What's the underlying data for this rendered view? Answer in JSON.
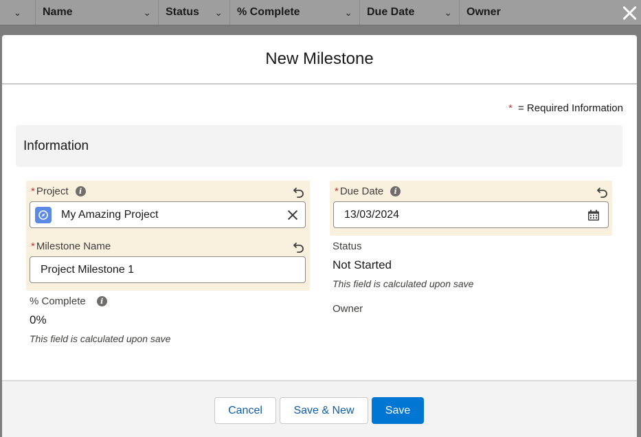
{
  "background_table": {
    "columns": [
      {
        "label": ""
      },
      {
        "label": "Name"
      },
      {
        "label": "Status"
      },
      {
        "label": "% Complete"
      },
      {
        "label": "Due Date"
      },
      {
        "label": "Owner"
      }
    ]
  },
  "modal": {
    "title": "New Milestone",
    "required_note": "= Required Information",
    "required_star": "*",
    "section_title": "Information",
    "fields": {
      "project": {
        "label": "Project",
        "value": "My Amazing Project"
      },
      "milestone_name": {
        "label": "Milestone Name",
        "value": "Project Milestone 1"
      },
      "percent_complete": {
        "label": "% Complete",
        "value": "0%",
        "note": "This field is calculated upon save"
      },
      "due_date": {
        "label": "Due Date",
        "value": "13/03/2024"
      },
      "status": {
        "label": "Status",
        "value": "Not Started",
        "note": "This field is calculated upon save"
      },
      "owner": {
        "label": "Owner"
      }
    },
    "buttons": {
      "cancel": "Cancel",
      "save_new": "Save & New",
      "save": "Save"
    }
  },
  "colors": {
    "brand": "#0176d3",
    "required": "#c23934",
    "field_highlight": "#faf0de"
  },
  "icons": {
    "close": "close-icon",
    "info": "info-icon",
    "undo": "undo-icon",
    "lookup": "compass-icon",
    "clear": "clear-icon",
    "calendar": "calendar-icon",
    "column_menu": "chevron-down-icon"
  }
}
